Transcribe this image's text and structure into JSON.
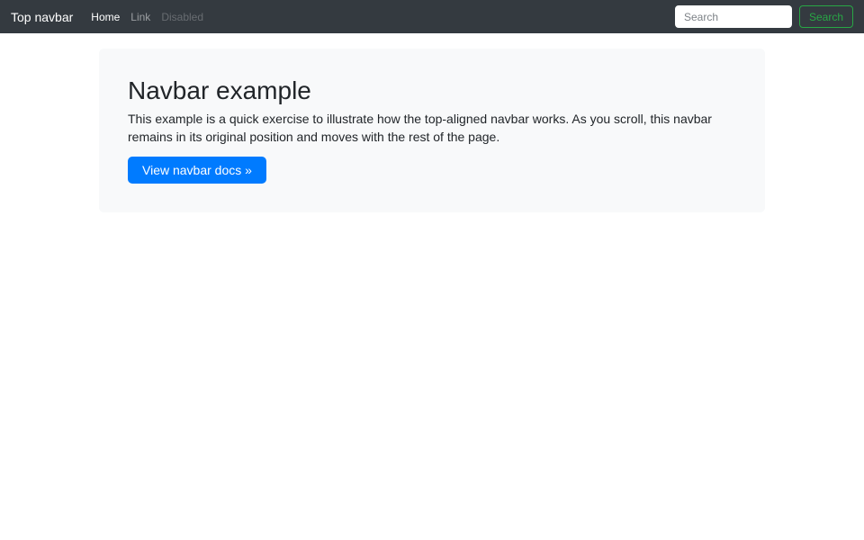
{
  "navbar": {
    "brand": "Top navbar",
    "items": [
      {
        "label": "Home",
        "state": "active"
      },
      {
        "label": "Link",
        "state": "normal"
      },
      {
        "label": "Disabled",
        "state": "disabled"
      }
    ],
    "search": {
      "placeholder": "Search",
      "button_label": "Search"
    }
  },
  "jumbotron": {
    "title": "Navbar example",
    "body": "This example is a quick exercise to illustrate how the top-aligned navbar works. As you scroll, this navbar remains in its original position and moves with the rest of the page.",
    "cta_label": "View navbar docs »"
  },
  "colors": {
    "navbar_bg": "#343a40",
    "primary": "#007bff",
    "success": "#28a745",
    "jumbotron_bg": "#f8f9fa",
    "text": "#212529"
  }
}
